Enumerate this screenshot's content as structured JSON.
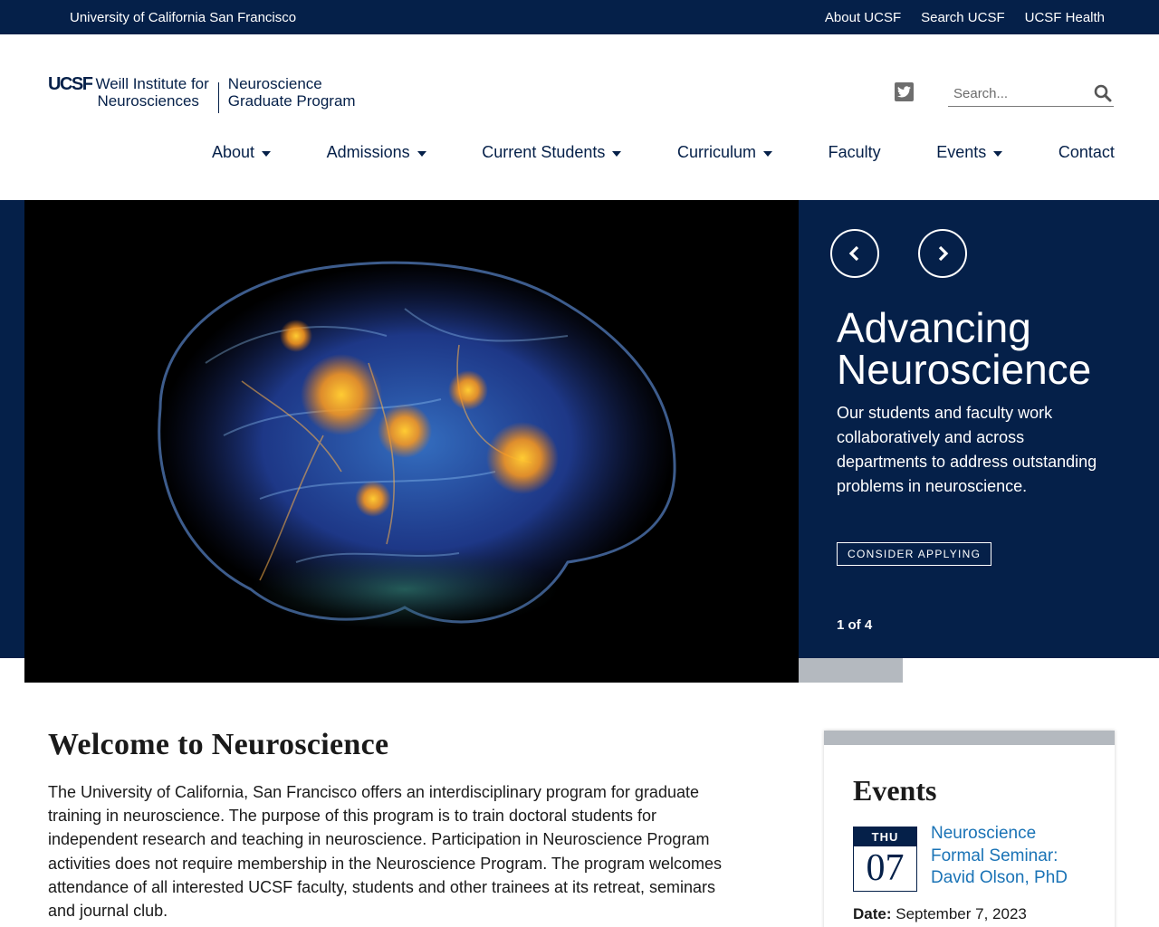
{
  "topbar": {
    "university": "University of California San Francisco",
    "links": [
      "About UCSF",
      "Search UCSF",
      "UCSF Health"
    ]
  },
  "logo": {
    "ucsf": "UCSF",
    "institute_line1": "Weill Institute for",
    "institute_line2": "Neurosciences",
    "program_line1": "Neuroscience",
    "program_line2": "Graduate Program"
  },
  "search": {
    "placeholder": "Search..."
  },
  "nav": [
    {
      "label": "About",
      "dropdown": true
    },
    {
      "label": "Admissions",
      "dropdown": true
    },
    {
      "label": "Current Students",
      "dropdown": true
    },
    {
      "label": "Curriculum",
      "dropdown": true
    },
    {
      "label": "Faculty",
      "dropdown": false
    },
    {
      "label": "Events",
      "dropdown": true
    },
    {
      "label": "Contact",
      "dropdown": false
    }
  ],
  "hero": {
    "title": "Advancing Neuroscience",
    "text": "Our students and faculty work collaboratively and across departments to address outstanding problems in neuroscience.",
    "cta": "CONSIDER APPLYING",
    "counter": "1 of 4",
    "progress_fraction": 0.29
  },
  "welcome": {
    "title": "Welcome to Neuroscience",
    "text": "The University of California, San Francisco offers an interdisciplinary program for graduate training in neuroscience. The purpose of this program is to train doctoral students for independent research and teaching in neuroscience. Participation in Neuroscience Program activities does not require membership in the Neuroscience Program. The program welcomes attendance of all interested UCSF faculty, students and other trainees at its retreat, seminars and journal club."
  },
  "events": {
    "title": "Events",
    "items": [
      {
        "dow": "THU",
        "day": "07",
        "title": "Neuroscience Formal Seminar: David Olson, PhD",
        "date_label": "Date:",
        "date": "September 7, 2023"
      }
    ]
  },
  "colors": {
    "navy": "#052049",
    "link": "#1a73b6",
    "grey_bar": "#b4b9bf"
  },
  "icons": [
    "twitter-icon",
    "search-icon",
    "chevron-left-icon",
    "chevron-right-icon",
    "caret-down-icon"
  ]
}
